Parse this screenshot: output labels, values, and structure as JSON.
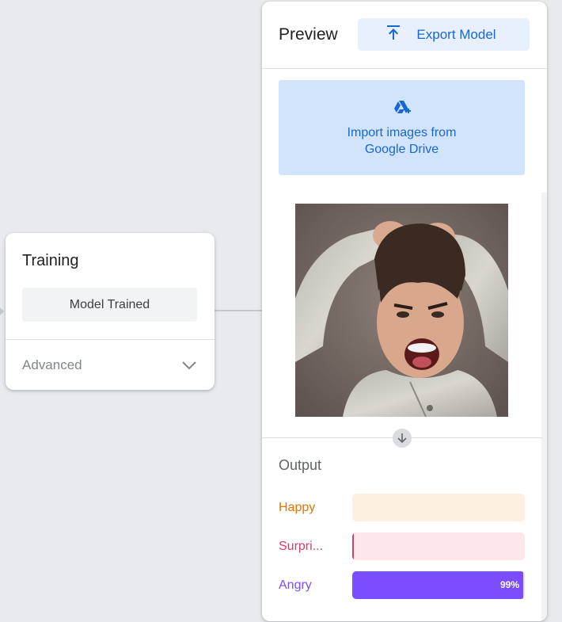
{
  "training": {
    "title": "Training",
    "status_button": "Model Trained",
    "advanced_label": "Advanced"
  },
  "preview": {
    "title": "Preview",
    "export_label": "Export Model",
    "import_label_line1": "Import images from",
    "import_label_line2": "Google Drive",
    "output_title": "Output",
    "classes": [
      {
        "label": "Happy",
        "text_color": "#e37400",
        "bg_color": "#feefe3",
        "fill_color": "#e37400",
        "confidence": 0
      },
      {
        "label": "Surpri...",
        "text_color": "#d93e6a",
        "bg_color": "#fde7ea",
        "fill_color": "#d93e6a",
        "confidence": 0.01
      },
      {
        "label": "Angry",
        "text_color": "#7c4dff",
        "bg_color": "#ede7fd",
        "fill_color": "#7c4dff",
        "confidence": 0.99,
        "percent_label": "99%"
      }
    ]
  },
  "icons": {
    "export": "upload-arrow-icon",
    "drive": "google-drive-add-icon",
    "chevron": "chevron-down-icon",
    "down_arrow": "arrow-down-icon"
  }
}
